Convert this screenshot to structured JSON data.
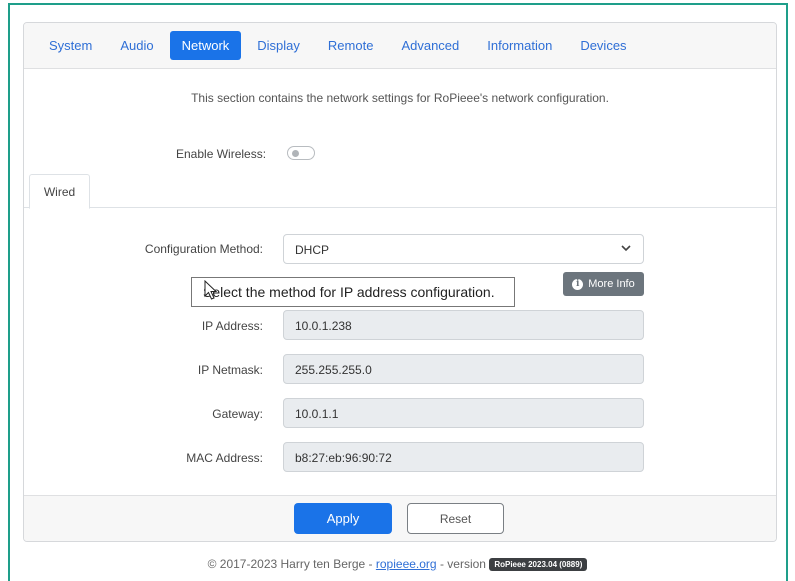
{
  "nav": {
    "tabs": [
      {
        "label": "System"
      },
      {
        "label": "Audio"
      },
      {
        "label": "Network",
        "active": true
      },
      {
        "label": "Display"
      },
      {
        "label": "Remote"
      },
      {
        "label": "Advanced"
      },
      {
        "label": "Information"
      },
      {
        "label": "Devices"
      }
    ]
  },
  "intro_text": "This section contains the network settings for RoPieee's network configuration.",
  "wireless": {
    "label": "Enable Wireless:",
    "enabled": false
  },
  "subtabs": [
    {
      "label": "Wired"
    }
  ],
  "config_method": {
    "label": "Configuration Method:",
    "value": "DHCP",
    "tooltip": "Select the method for IP address configuration.",
    "more_info_label": "More Info"
  },
  "fields": {
    "ip_address": {
      "label": "IP Address:",
      "value": "10.0.1.238"
    },
    "ip_netmask": {
      "label": "IP Netmask:",
      "value": "255.255.255.0"
    },
    "gateway": {
      "label": "Gateway:",
      "value": "10.0.1.1"
    },
    "mac_address": {
      "label": "MAC Address:",
      "value": "b8:27:eb:96:90:72"
    }
  },
  "actions": {
    "apply_label": "Apply",
    "reset_label": "Reset"
  },
  "footer": {
    "copyright": "© 2017-2023 Harry ten Berge -",
    "link": "ropieee.org",
    "version_prefix": "- version",
    "version_badge": "RoPieee 2023.04 (0889)"
  },
  "colors": {
    "accent": "#1a73e8",
    "frame": "#1e9e8a",
    "badge": "#3c3f42",
    "more_info": "#6c757d"
  },
  "icons": {
    "select_chevron": "chevron-down-icon",
    "info": "info-circle-icon",
    "pointer": "mouse-cursor-icon"
  }
}
